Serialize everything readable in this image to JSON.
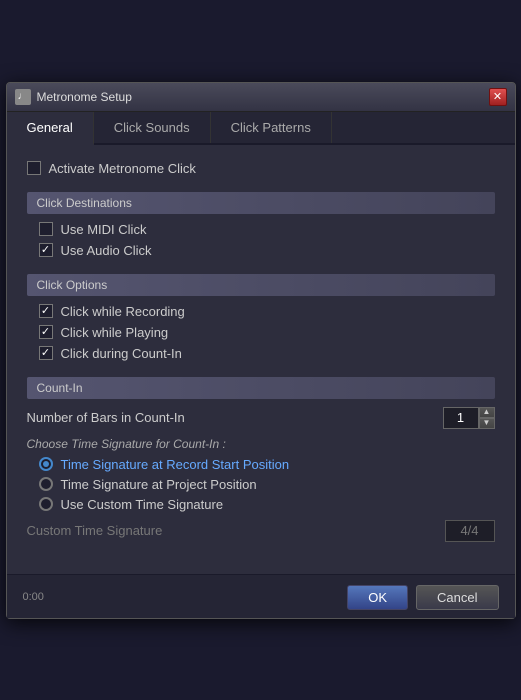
{
  "window": {
    "title": "Metronome Setup",
    "icon": "♩"
  },
  "tabs": [
    {
      "id": "general",
      "label": "General",
      "active": true
    },
    {
      "id": "click-sounds",
      "label": "Click Sounds",
      "active": false
    },
    {
      "id": "click-patterns",
      "label": "Click Patterns",
      "active": false
    }
  ],
  "general": {
    "activate_label": "Activate Metronome Click",
    "activate_checked": false,
    "click_destinations": {
      "header": "Click Destinations",
      "use_midi": {
        "label": "Use MIDI Click",
        "checked": false
      },
      "use_audio": {
        "label": "Use Audio Click",
        "checked": true
      }
    },
    "click_options": {
      "header": "Click Options",
      "while_recording": {
        "label": "Click while Recording",
        "checked": true
      },
      "while_playing": {
        "label": "Click while Playing",
        "checked": true
      },
      "during_count_in": {
        "label": "Click during Count-In",
        "checked": true
      }
    },
    "count_in": {
      "header": "Count-In",
      "bars_label": "Number of Bars in Count-In",
      "bars_value": "1",
      "choose_label": "Choose Time Signature for Count-In :",
      "radio_options": [
        {
          "id": "record-start",
          "label": "Time Signature at Record Start Position",
          "selected": true
        },
        {
          "id": "project-pos",
          "label": "Time Signature at Project Position",
          "selected": false
        },
        {
          "id": "custom",
          "label": "Use Custom Time Signature",
          "selected": false
        }
      ],
      "custom_sig_label": "Custom Time Signature",
      "custom_sig_value": "4/4"
    }
  },
  "footer": {
    "ok_label": "OK",
    "cancel_label": "Cancel",
    "time": "0:00"
  }
}
